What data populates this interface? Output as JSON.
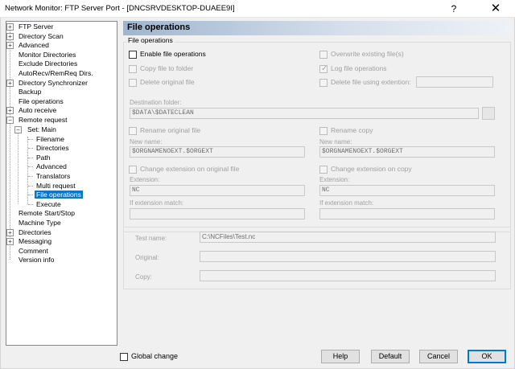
{
  "window": {
    "title": "Network Monitor: FTP Server Port - [DNCSRVDESKTOP-DUAEE9I]",
    "help_glyph": "?",
    "close_glyph": "✕"
  },
  "tree": {
    "items": [
      {
        "label": "FTP Server"
      },
      {
        "label": "Directory Scan"
      },
      {
        "label": "Advanced"
      },
      {
        "label": "Monitor Directories"
      },
      {
        "label": "Exclude Directories"
      },
      {
        "label": "AutoRecv/RemReq Dirs."
      },
      {
        "label": "Directory Synchronizer"
      },
      {
        "label": "Backup"
      },
      {
        "label": "File operations"
      },
      {
        "label": "Auto receive"
      },
      {
        "label": "Remote request"
      },
      {
        "label": "Set: Main"
      },
      {
        "label": "Filename"
      },
      {
        "label": "Directories"
      },
      {
        "label": "Path"
      },
      {
        "label": "Advanced"
      },
      {
        "label": "Translators"
      },
      {
        "label": "Multi request"
      },
      {
        "label": "File operations"
      },
      {
        "label": "Execute"
      },
      {
        "label": "Remote Start/Stop"
      },
      {
        "label": "Machine Type"
      },
      {
        "label": "Directories"
      },
      {
        "label": "Messaging"
      },
      {
        "label": "Comment"
      },
      {
        "label": "Version info"
      }
    ],
    "plus_glyph": "+",
    "minus_glyph": "−"
  },
  "panel": {
    "title": "File operations",
    "group_label": "File operations",
    "enable_file_operations": "Enable file operations",
    "overwrite_existing": "Overwrite existing file(s)",
    "copy_file_to_folder": "Copy file to folder",
    "log_file_operations": "Log file operations",
    "delete_original_file": "Delete original file",
    "delete_file_using_extension": "Delete file using extention:",
    "destination_folder_label": "Destination folder:",
    "destination_folder_value": "$DATA\\$DATECLEAN",
    "rename_original_file": "Rename original file",
    "rename_copy": "Rename copy",
    "new_name_label_left": "New name:",
    "new_name_value_left": "$ORGNAMENOEXT.$ORGEXT",
    "new_name_label_right": "New name:",
    "new_name_value_right": "$ORGNAMENOEXT.$ORGEXT",
    "change_ext_original": "Change extension on original file",
    "change_ext_copy": "Change extension on copy",
    "extension_label_left": "Extension:",
    "extension_value_left": "NC",
    "extension_label_right": "Extension:",
    "extension_value_right": "NC",
    "if_ext_match_left": "If extension match:",
    "if_ext_match_right": "If extension match:",
    "check_glyph": "✓"
  },
  "test": {
    "test_name_label": "Test name:",
    "test_name_value": "C:\\NCFiles\\Test.nc",
    "original_label": "Original:",
    "copy_label": "Copy:"
  },
  "footer": {
    "global_change": "Global change",
    "help": "Help",
    "default": "Default",
    "cancel": "Cancel",
    "ok": "OK"
  }
}
